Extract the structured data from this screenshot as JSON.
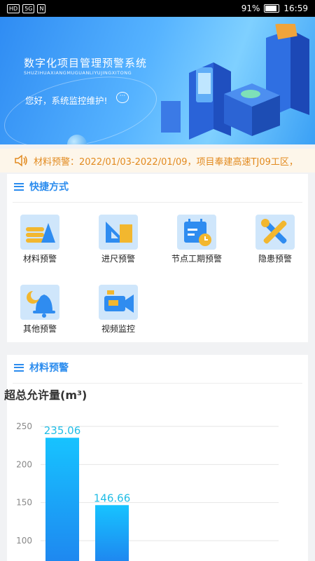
{
  "status_bar": {
    "left_badges": [
      "HD",
      "5G",
      "N",
      "⏰",
      "🎧"
    ],
    "battery": "91%",
    "time": "16:59"
  },
  "banner": {
    "title": "数字化项目管理预警系统",
    "pinyin": "SHUZIHUAXIANGMUGUANLIYUJINGXITONG",
    "greeting": "您好，系统监控维护!"
  },
  "notice": {
    "icon": "speaker-icon",
    "text": "材料预警：2022/01/03-2022/01/09，项目奉建高速TJ09工区，"
  },
  "shortcuts": {
    "title": "快捷方式",
    "items": [
      {
        "label": "材料预警",
        "icon": "materials-icon"
      },
      {
        "label": "进尺预警",
        "icon": "ruler-icon"
      },
      {
        "label": "节点工期预警",
        "icon": "calendar-icon"
      },
      {
        "label": "隐患预警",
        "icon": "tools-icon"
      },
      {
        "label": "其他预警",
        "icon": "bell-icon"
      },
      {
        "label": "视频监控",
        "icon": "camera-icon"
      }
    ]
  },
  "material_warning": {
    "title": "材料预警"
  },
  "chart_data": {
    "type": "bar",
    "title": "超总允许量(m³)",
    "categories": [
      "",
      ""
    ],
    "values": [
      235.06,
      146.66
    ],
    "value_labels": [
      "235.06",
      "146.66"
    ],
    "yticks": [
      "100",
      "150",
      "200",
      "250"
    ],
    "ylim": [
      90,
      260
    ],
    "grid": true,
    "colors": {
      "bar_top": "#17c3ff",
      "bar_bottom": "#1e88f0",
      "label": "#21bde6"
    }
  }
}
